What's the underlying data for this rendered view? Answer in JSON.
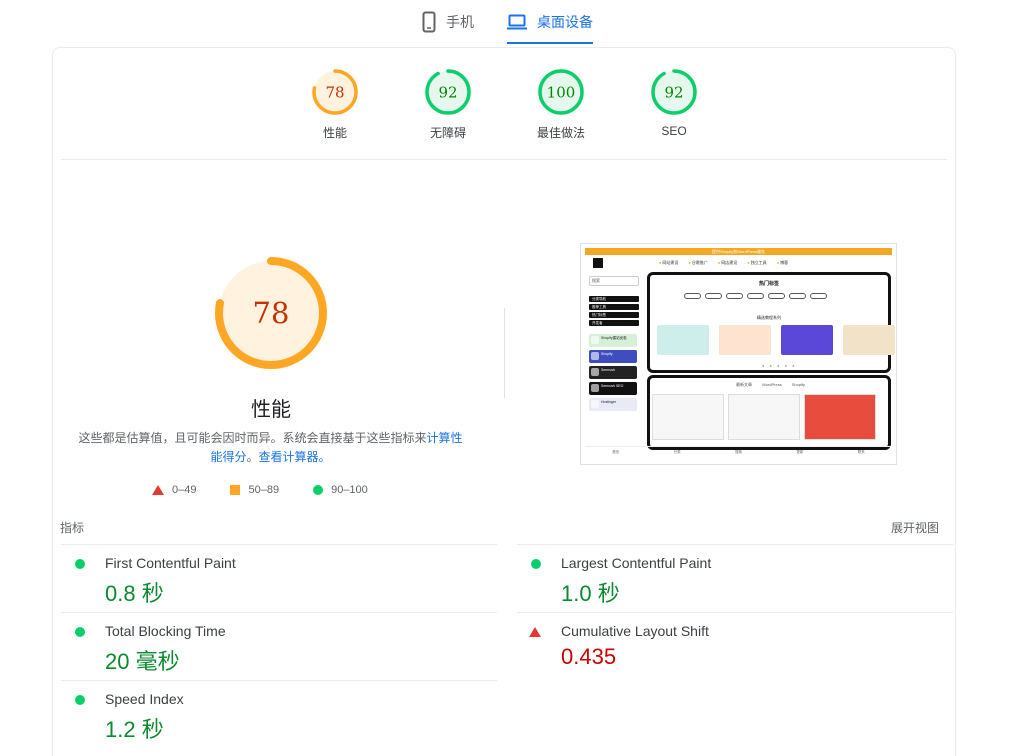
{
  "device_tabs": {
    "mobile_label": "手机",
    "desktop_label": "桌面设备",
    "active": "desktop"
  },
  "gauges": [
    {
      "value": "78",
      "label": "性能",
      "score": 78,
      "color": "#ffa724",
      "bg": "#fff3e0",
      "text_color": "#c33300"
    },
    {
      "value": "92",
      "label": "无障碍",
      "score": 92,
      "color": "#0cce6b",
      "bg": "#e6f8ee",
      "text_color": "#008800"
    },
    {
      "value": "100",
      "label": "最佳做法",
      "score": 100,
      "color": "#0cce6b",
      "bg": "#e6f8ee",
      "text_color": "#008800"
    },
    {
      "value": "92",
      "label": "SEO",
      "score": 92,
      "color": "#0cce6b",
      "bg": "#e6f8ee",
      "text_color": "#008800"
    }
  ],
  "performance": {
    "score": "78",
    "title": "性能",
    "desc_text": "这些都是估算值，且可能会因时而异。系统会直接基于这些指标来",
    "desc_link1": "计算性能得分",
    "desc_mid": "。",
    "desc_link2": "查看计算器。"
  },
  "legend": {
    "fail": "0–49",
    "average": "50–89",
    "pass": "90–100"
  },
  "thumbnail": {
    "topbar": "提供Shopify和WordPress服务",
    "nav": [
      "网站建设",
      "谷歌推广",
      "网店建设",
      "独立工具",
      "博客"
    ],
    "search": "搜索",
    "side_blocks": [
      "分类导航",
      "推荐工具",
      "热门标签",
      "开发者"
    ],
    "side_ads": [
      "Shopify建站优惠",
      "Shopify",
      "Semrush",
      "Semrush SEO",
      "Hostinger"
    ],
    "panel_title": "热门标签",
    "panel_pills": [
      "WordPress",
      "Shopify",
      "建站教程",
      "谷歌SEO",
      "独立站",
      "外贸建站",
      "插件"
    ],
    "panel_sub": "精选教程系列",
    "panel2_tabs": [
      "最新文章",
      "WordPress",
      "Shopify"
    ],
    "footer": [
      "首页",
      "分类",
      "搜索",
      "更新",
      "联系"
    ]
  },
  "metrics": {
    "header": "指标",
    "expand": "展开视图",
    "items": [
      {
        "title": "First Contentful Paint",
        "value": "0.8 秒",
        "status": "pass"
      },
      {
        "title": "Largest Contentful Paint",
        "value": "1.0 秒",
        "status": "pass"
      },
      {
        "title": "Total Blocking Time",
        "value": "20 毫秒",
        "status": "pass"
      },
      {
        "title": "Cumulative Layout Shift",
        "value": "0.435",
        "status": "fail"
      },
      {
        "title": "Speed Index",
        "value": "1.2 秒",
        "status": "pass"
      }
    ]
  }
}
